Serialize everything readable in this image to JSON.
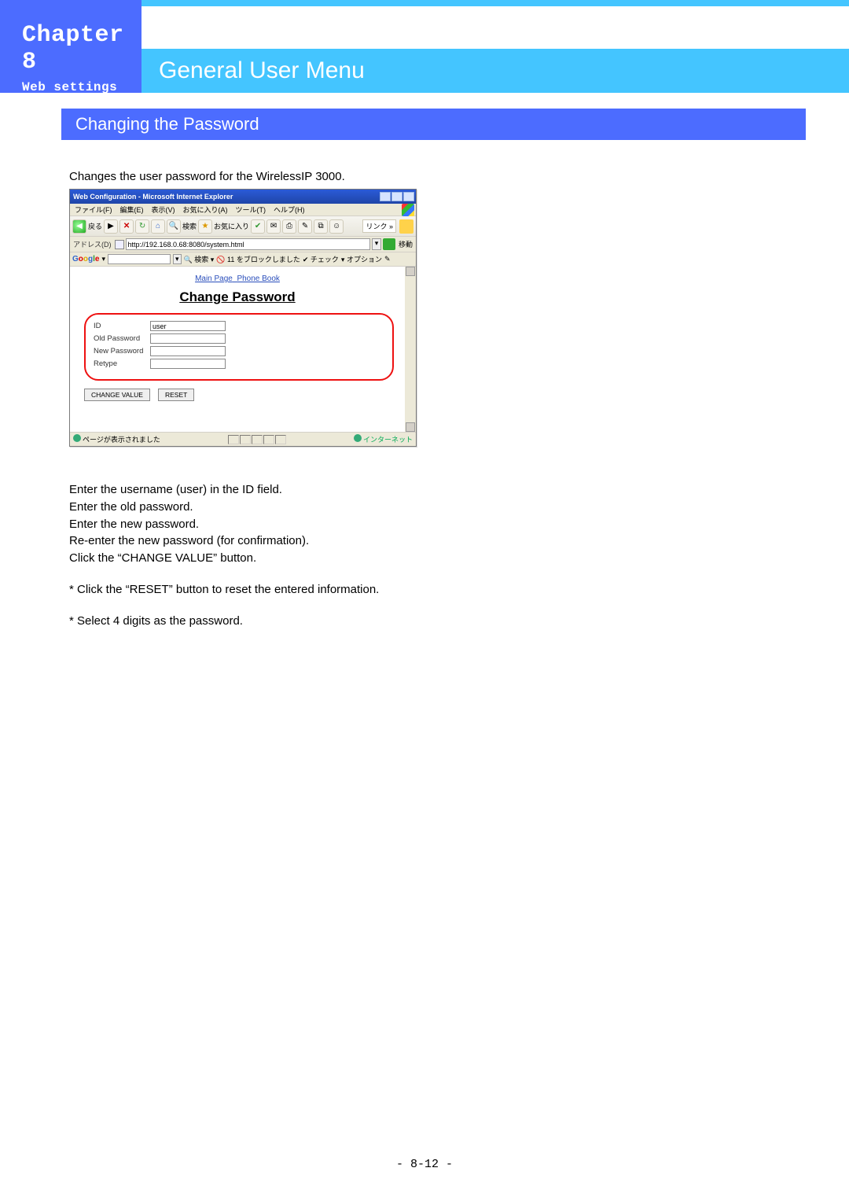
{
  "sidebar": {
    "chapter": "Chapter 8",
    "subchapter": "Web settings"
  },
  "page_title": "General User Menu",
  "section_title": "Changing the Password",
  "intro_text": "Changes the user password for the WirelessIP 3000.",
  "ie": {
    "window_title": "Web Configuration - Microsoft Internet Explorer",
    "menus": [
      "ファイル(F)",
      "編集(E)",
      "表示(V)",
      "お気に入り(A)",
      "ツール(T)",
      "ヘルプ(H)"
    ],
    "back_label": "戻る",
    "search_label": "検索",
    "fav_label": "お気に入り",
    "links_label": "リンク »",
    "addr_label": "アドレス(D)",
    "addr_value": "http://192.168.0.68:8080/system.html",
    "go_label": "移動",
    "google_label": "Google",
    "google_search": "検索",
    "google_blocked": "11 をブロックしました",
    "google_check": "チェック",
    "google_option": "オプション",
    "top_main": "Main Page",
    "top_phone": "Phone Book",
    "cp_title": "Change Password",
    "field_id": "ID",
    "field_id_value": "user",
    "field_old": "Old Password",
    "field_new": "New Password",
    "field_retype": "Retype",
    "btn_change": "CHANGE VALUE",
    "btn_reset": "RESET",
    "status_left": "ページが表示されました",
    "status_right": "インターネット"
  },
  "instructions": {
    "line1": "Enter the username (user) in the ID field.",
    "line2": "Enter the old password.",
    "line3": "Enter the new password.",
    "line4": "Re-enter the new password (for confirmation).",
    "line5": "Click the “CHANGE VALUE” button.",
    "note1": "* Click the “RESET” button to reset the entered information.",
    "note2": "* Select 4 digits as the password."
  },
  "page_number": "- 8-12 -"
}
